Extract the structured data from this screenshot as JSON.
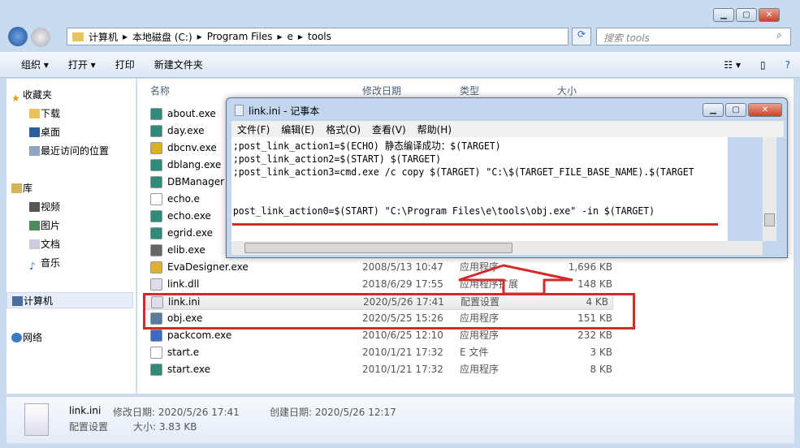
{
  "explorer": {
    "breadcrumb": [
      "计算机",
      "本地磁盘 (C:)",
      "Program Files",
      "e",
      "tools"
    ],
    "search_placeholder": "搜索 tools",
    "toolbar": {
      "organize": "组织 ▾",
      "open": "打开 ▾",
      "print": "打印",
      "new_folder": "新建文件夹"
    },
    "sidebar": {
      "favorites": "收藏夹",
      "downloads": "下载",
      "desktop": "桌面",
      "recent": "最近访问的位置",
      "library": "库",
      "videos": "视频",
      "pictures": "图片",
      "documents": "文档",
      "music": "音乐",
      "computer": "计算机",
      "network": "网络"
    },
    "columns": {
      "name": "名称",
      "date": "修改日期",
      "type": "类型",
      "size": "大小"
    },
    "files": [
      {
        "name": "about.exe",
        "date": "",
        "type": "",
        "size": ""
      },
      {
        "name": "day.exe",
        "date": "",
        "type": "",
        "size": ""
      },
      {
        "name": "dbcnv.exe",
        "date": "",
        "type": "",
        "size": ""
      },
      {
        "name": "dblang.exe",
        "date": "",
        "type": "",
        "size": ""
      },
      {
        "name": "DBManager",
        "date": "",
        "type": "",
        "size": ""
      },
      {
        "name": "echo.e",
        "date": "",
        "type": "",
        "size": ""
      },
      {
        "name": "echo.exe",
        "date": "",
        "type": "",
        "size": ""
      },
      {
        "name": "egrid.exe",
        "date": "",
        "type": "",
        "size": ""
      },
      {
        "name": "elib.exe",
        "date": "",
        "type": "",
        "size": ""
      },
      {
        "name": "EvaDesigner.exe",
        "date": "2008/5/13 10:47",
        "type": "应用程序",
        "size": "1,696 KB"
      },
      {
        "name": "link.dll",
        "date": "2018/6/29 17:55",
        "type": "应用程序扩展",
        "size": "148 KB"
      },
      {
        "name": "link.ini",
        "date": "2020/5/26 17:41",
        "type": "配置设置",
        "size": "4 KB"
      },
      {
        "name": "obj.exe",
        "date": "2020/5/25 15:26",
        "type": "应用程序",
        "size": "151 KB"
      },
      {
        "name": "packcom.exe",
        "date": "2010/6/25 12:10",
        "type": "应用程序",
        "size": "232 KB"
      },
      {
        "name": "start.e",
        "date": "2010/1/21 17:32",
        "type": "E 文件",
        "size": "3 KB"
      },
      {
        "name": "start.exe",
        "date": "2010/1/21 17:32",
        "type": "应用程序",
        "size": "8 KB"
      }
    ],
    "status": {
      "filename": "link.ini",
      "modified": "修改日期: 2020/5/26 17:41",
      "created": "创建日期: 2020/5/26 12:17",
      "type": "配置设置",
      "size": "大小: 3.83 KB"
    }
  },
  "notepad": {
    "title": "link.ini - 记事本",
    "menu": [
      "文件(F)",
      "编辑(E)",
      "格式(O)",
      "查看(V)",
      "帮助(H)"
    ],
    "lines": [
      ";post_link_action1=$(ECHO) 静态编译成功：$(TARGET)",
      ";post_link_action2=$(START) $(TARGET)",
      ";post_link_action3=cmd.exe /c copy $(TARGET) \"C:\\$(TARGET_FILE_BASE_NAME).$(TARGET",
      "",
      "",
      "post_link_action0=$(START) \"C:\\Program Files\\e\\tools\\obj.exe\" -in $(TARGET)"
    ]
  },
  "colors": {
    "annotation": "#d42a2a",
    "selection": "#e8e8e8"
  }
}
